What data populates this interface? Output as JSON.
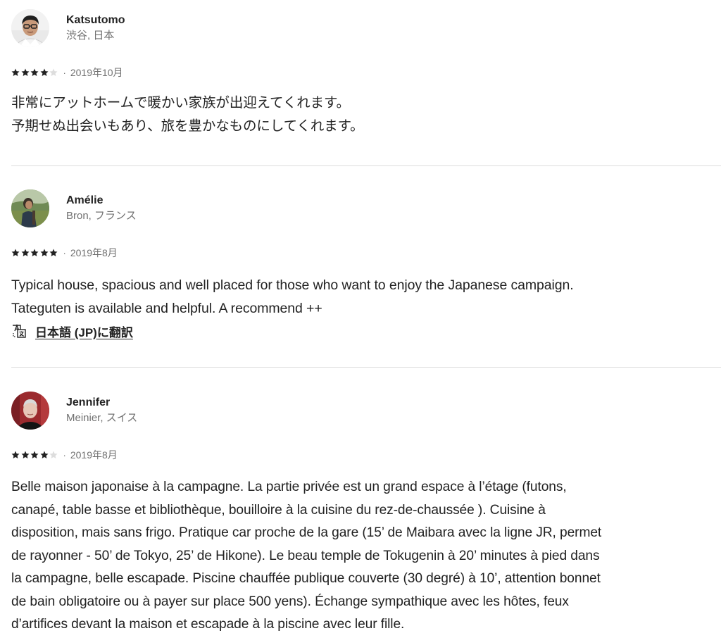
{
  "reviews": [
    {
      "name": "Katsutomo",
      "location": "渋谷, 日本",
      "rating": 4,
      "separator": "·",
      "date": "2019年10月",
      "text": "非常にアットホームで暖かい家族が出迎えてくれます。\n予期せぬ出会いもあり、旅を豊かなものにしてくれます。",
      "avatar_icon": "person-glasses-avatar"
    },
    {
      "name": "Amélie",
      "location": "Bron, フランス",
      "rating": 5,
      "separator": "·",
      "date": "2019年8月",
      "text": "Typical house, spacious and well placed for those who want to enjoy the Japanese campaign.\nTateguten is available and helpful. A recommend ++",
      "translate_label": "日本語 (JP)に翻訳",
      "translate_icon": "translate-icon",
      "avatar_icon": "person-outdoor-avatar"
    },
    {
      "name": "Jennifer",
      "location": "Meinier, スイス",
      "rating": 4,
      "separator": "·",
      "date": "2019年8月",
      "text": "Belle maison japonaise à la campagne. La partie privée est un grand espace à l’étage (futons,\ncanapé, table basse et bibliothèque, bouilloire à la cuisine du rez-de-chaussée ). Cuisine à\ndisposition, mais sans frigo. Pratique car proche de la gare (15’ de Maibara avec la ligne JR, permet\nde rayonner - 50’ de Tokyo, 25’ de Hikone). Le beau temple de Tokugenin à 20’ minutes à pied dans\nla campagne, belle escapade. Piscine chauffée publique couverte (30 degré) à 10’, attention bonnet\nde bain obligatoire ou à payer sur place 500 yens). Échange sympathique avec les hôtes, feux\nd’artifices devant la maison et escapade à la piscine avec leur fille.",
      "avatar_icon": "person-red-background-avatar"
    }
  ],
  "colors": {
    "text_primary": "#222222",
    "text_secondary": "#717171",
    "star_filled": "#222222",
    "star_empty": "#dddddd",
    "divider": "#dddddd"
  }
}
